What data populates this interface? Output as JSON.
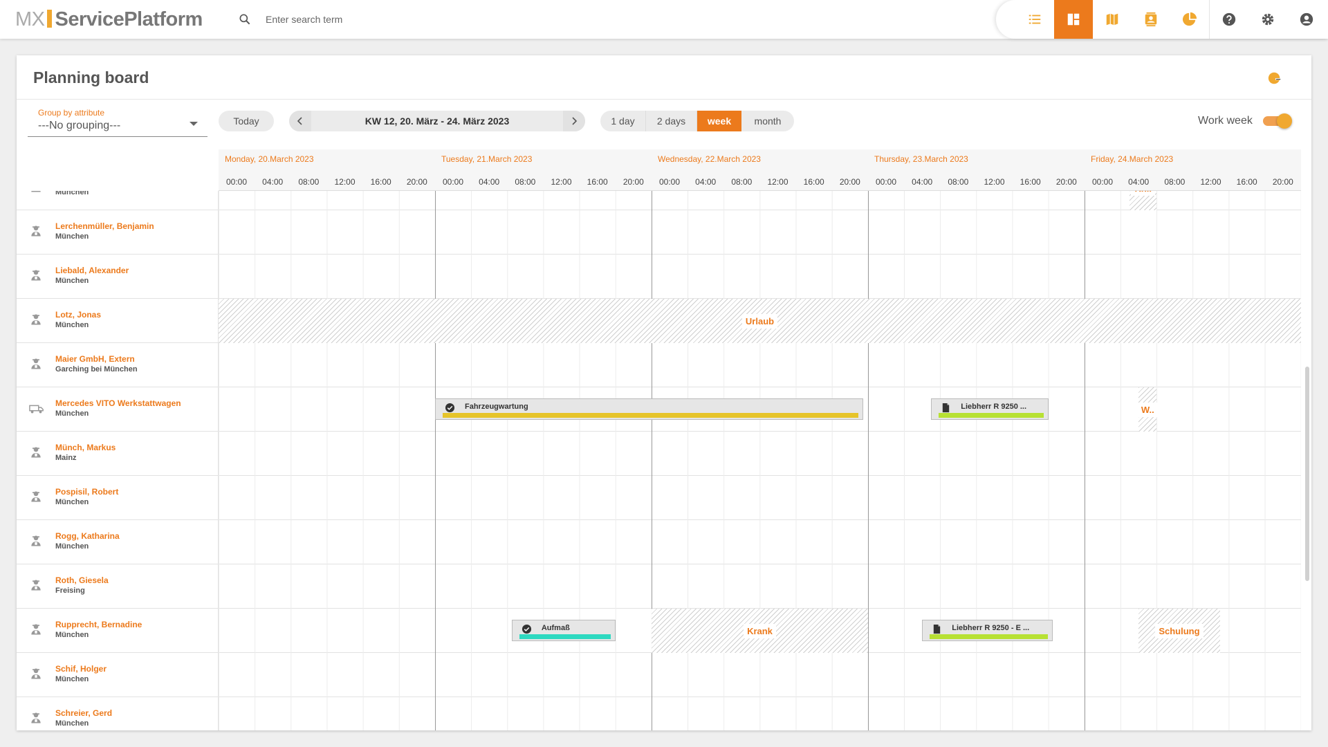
{
  "app": {
    "logo_mx": "MX",
    "logo_name": "ServicePlatform"
  },
  "search": {
    "placeholder": "Enter search term"
  },
  "toolbar": {
    "icons": [
      "list-icon",
      "dashboard-icon",
      "map-icon",
      "contacts-icon",
      "pie-chart-icon",
      "help-icon",
      "settings-icon",
      "account-icon"
    ],
    "active": "dashboard-icon"
  },
  "colors": {
    "accent": "#ec7a1c",
    "teal": "#2dd9c0",
    "lime": "#b7e133",
    "yellow": "#e6c42a"
  },
  "page": {
    "title": "Planning board"
  },
  "controls": {
    "group_label": "Group by attribute",
    "group_value": "---No grouping---",
    "today": "Today",
    "range": "KW 12, 20. März - 24. März 2023",
    "views": [
      "1 day",
      "2 days",
      "week",
      "month"
    ],
    "active_view": "week",
    "work_week_label": "Work week",
    "work_week_on": true
  },
  "days": [
    {
      "label": "Monday, 20.March 2023"
    },
    {
      "label": "Tuesday, 21.March 2023"
    },
    {
      "label": "Wednesday, 22.March 2023"
    },
    {
      "label": "Thursday, 23.March 2023"
    },
    {
      "label": "Friday, 24.March 2023"
    }
  ],
  "hours": [
    "00:00",
    "04:00",
    "08:00",
    "12:00",
    "16:00",
    "20:00"
  ],
  "resources": [
    {
      "name": "",
      "city": "München",
      "type": "person"
    },
    {
      "name": "Lerchenmüller, Benjamin",
      "city": "München",
      "type": "person"
    },
    {
      "name": "Liebald, Alexander",
      "city": "München",
      "type": "person"
    },
    {
      "name": "Lotz, Jonas",
      "city": "München",
      "type": "person"
    },
    {
      "name": "Maier GmbH, Extern",
      "city": "Garching bei München",
      "type": "person"
    },
    {
      "name": "Mercedes VITO Werkstattwagen",
      "city": "München",
      "type": "vehicle"
    },
    {
      "name": "Münch, Markus",
      "city": "Mainz",
      "type": "person"
    },
    {
      "name": "Pospisil, Robert",
      "city": "München",
      "type": "person"
    },
    {
      "name": "Rogg, Katharina",
      "city": "München",
      "type": "person"
    },
    {
      "name": "Roth, Giesela",
      "city": "Freising",
      "type": "person"
    },
    {
      "name": "Rupprecht, Bernadine",
      "city": "München",
      "type": "person"
    },
    {
      "name": "Schif, Holger",
      "city": "München",
      "type": "person"
    },
    {
      "name": "Schreier, Gerd",
      "city": "München",
      "type": "person"
    }
  ],
  "absences": [
    {
      "row": 3,
      "label": "Urlaub",
      "start": "2023-03-20T00:00",
      "end": "2023-03-24T24:00"
    },
    {
      "row": 5,
      "label": "W..",
      "start": "2023-03-24T06:00",
      "end": "2023-03-24T08:00"
    },
    {
      "row": 10,
      "label": "Krank",
      "start": "2023-03-22T00:00",
      "end": "2023-03-22T24:00"
    },
    {
      "row": 10,
      "label": "Schulung",
      "start": "2023-03-24T06:00",
      "end": "2023-03-24T15:00"
    },
    {
      "row": 0,
      "label": "Kr...",
      "start": "2023-03-24T05:00",
      "end": "2023-03-24T08:00"
    }
  ],
  "events": [
    {
      "row": 5,
      "label": "Fahrzeugwartung",
      "icon": "check-badge-icon",
      "color": "yellow",
      "start": "2023-03-21T00:00",
      "end": "2023-03-22T23:30"
    },
    {
      "row": 5,
      "label": "Liebherr R 9250 ...",
      "icon": "document-icon",
      "color": "lime",
      "start": "2023-03-23T07:00",
      "end": "2023-03-23T20:00"
    },
    {
      "row": 10,
      "label": "Aufmaß",
      "icon": "check-badge-icon",
      "color": "teal",
      "start": "2023-03-21T08:30",
      "end": "2023-03-21T20:00"
    },
    {
      "row": 10,
      "label": "Liebherr R 9250 - E ...",
      "icon": "document-icon",
      "color": "lime",
      "start": "2023-03-23T06:00",
      "end": "2023-03-23T20:30"
    },
    {
      "row": 0,
      "label": "",
      "icon": "",
      "color": "teal",
      "start": "2023-03-21T04:00",
      "end": "2023-03-21T08:00"
    },
    {
      "row": 0,
      "label": "",
      "icon": "",
      "color": "lime",
      "start": "2023-03-22T15:00",
      "end": "2023-03-22T20:30"
    },
    {
      "row": 0,
      "label": "",
      "icon": "",
      "color": "lime",
      "start": "2023-03-23T14:00",
      "end": "2023-03-23T21:00"
    },
    {
      "row": 0,
      "label": "",
      "icon": "",
      "color": "lime",
      "start": "2023-03-24T10:00",
      "end": "2023-03-24T16:00"
    }
  ]
}
